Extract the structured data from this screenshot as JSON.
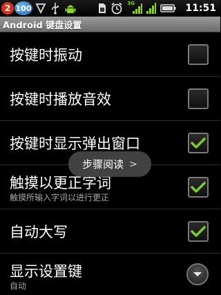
{
  "status_bar": {
    "notification_count": "2",
    "battery_badge": "100",
    "network_label": "3G",
    "time": "11:51",
    "icons": [
      "notification-badge-icon",
      "battery-level-badge-icon",
      "shield-icon",
      "usb-icon",
      "android-icon",
      "sim-icon",
      "alarm-icon",
      "signal-icon",
      "wifi-icon",
      "battery-icon"
    ]
  },
  "title_bar": {
    "title": "Android 键盘设置"
  },
  "settings": [
    {
      "title": "按键时振动",
      "subtitle": "",
      "control": "checkbox",
      "checked": false
    },
    {
      "title": "按键时播放音效",
      "subtitle": "",
      "control": "checkbox",
      "checked": false
    },
    {
      "title": "按键时显示弹出窗口",
      "subtitle": "",
      "control": "checkbox",
      "checked": true
    },
    {
      "title": "触摸以更正字词",
      "subtitle": "触摸所输入字词以进行更正",
      "control": "checkbox",
      "checked": true
    },
    {
      "title": "自动大写",
      "subtitle": "",
      "control": "checkbox",
      "checked": true
    },
    {
      "title": "显示设置键",
      "subtitle": "自动",
      "control": "dropdown",
      "checked": false
    }
  ],
  "toast": {
    "label": "步骤阅读",
    "arrow_icon": "chevron-right-icon"
  },
  "colors": {
    "check_green": "#7ecb2e",
    "notification_red": "#d8321e"
  }
}
